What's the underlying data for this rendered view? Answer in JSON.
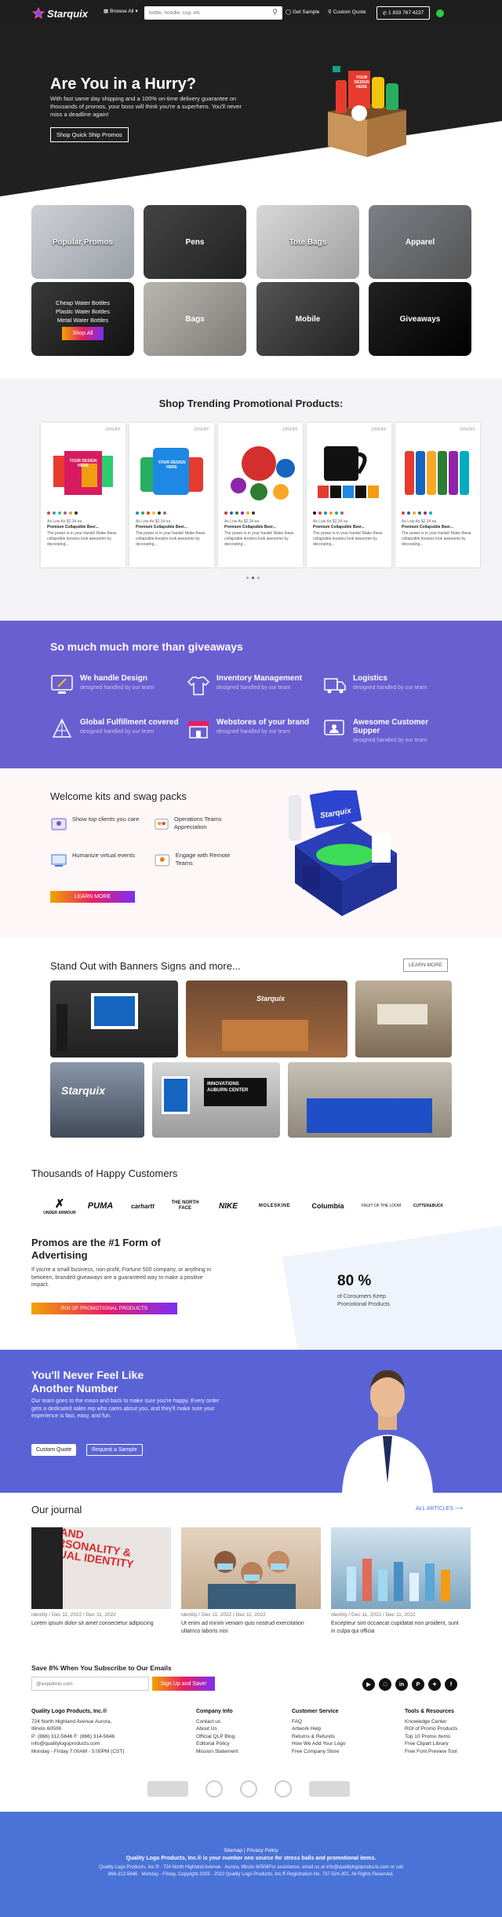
{
  "header": {
    "logo": "Starquix",
    "browse": "Browse All",
    "search_placeholder": "bottle, hoodie, cup, etc",
    "get_sample": "Get Sample",
    "custom_quote": "Custom Quote",
    "phone": "1 833 767 4237"
  },
  "hero": {
    "title": "Are You in a Hurry?",
    "body": "With fast same day shipping and a 100% on-time delivery guarantee on thousands of promos, your boss will think you're a superhero. You'll never miss a deadline again!",
    "button": "Shop Quick Ship Promos",
    "box_text": "YOUR DESIGN HERE"
  },
  "categories": [
    {
      "label": "Popular Promos"
    },
    {
      "label": "Pens"
    },
    {
      "label": "Tote Bags"
    },
    {
      "label": "Apparel"
    },
    {
      "label": "Cheap Water Bottles\nPlastic Water Bottles\nMetal Water Bottles"
    },
    {
      "label": "Bags"
    },
    {
      "label": "Mobile"
    },
    {
      "label": "Giveaways"
    }
  ],
  "categories_shop_all": "Shop All",
  "trending": {
    "title": "Shop Trending Promotional Products:",
    "products": [
      {
        "tag": "10%OFF",
        "price": "As Low As $2.34 ea",
        "title": "Premium Collapsible Beer...",
        "desc": "The power is in your hands! Make these collapsible koozies look awesome by decorating..."
      },
      {
        "tag": "10%OFF",
        "price": "As Low As $2.34 ea",
        "title": "Premium Collapsible Beer...",
        "desc": "The power is in your hands! Make these collapsible koozies look awesome by decorating..."
      },
      {
        "tag": "10%OFF",
        "price": "As Low As $2.34 ea",
        "title": "Premium Collapsible Beer...",
        "desc": "The power is in your hands! Make these collapsible koozies look awesome by decorating..."
      },
      {
        "tag": "10%OFF",
        "price": "As Low As $2.34 ea",
        "title": "Premium Collapsible Beer...",
        "desc": "The power is in your hands! Make these collapsible koozies look awesome by decorating..."
      },
      {
        "tag": "10%OFF",
        "price": "As Low As $2.34 ea",
        "title": "Premium Collapsible Beer...",
        "desc": "The power is in your hands! Make these collapsible koozies look awesome by decorating..."
      }
    ],
    "print_text": "YOUR DESIGN HERE"
  },
  "features": {
    "title": "So much much more than giveaways",
    "items": [
      {
        "title": "We handle Design",
        "sub": "designed handled by our team"
      },
      {
        "title": "Inventory Management",
        "sub": "designed handled by our team"
      },
      {
        "title": "Logistics",
        "sub": "designed handled by our team"
      },
      {
        "title": "Global Fulfillment covered",
        "sub": "designed handled by our team"
      },
      {
        "title": "Webstores of your brand",
        "sub": "designed handled by our team"
      },
      {
        "title": "Awesome Customer Supper",
        "sub": "designed handled by our team"
      }
    ]
  },
  "kits": {
    "title": "Welcome kits and swag packs",
    "items": [
      "Show top clients you care",
      "Operations Teams Appreciation",
      "Humanize virtual events",
      "Engage with Remote Teams"
    ],
    "button": "LEARN MORE",
    "brand": "Starquix"
  },
  "banners": {
    "title": "Stand Out with Banners Signs and more...",
    "button": "LEARN MORE",
    "sign1": "Starquix",
    "sign2": "INNOVATIONS\nAUBURN CENTER"
  },
  "customers": {
    "title": "Thousands of Happy Customers",
    "logos": [
      "UNDER ARMOUR",
      "PUMA",
      "carhartt",
      "THE NORTH FACE",
      "NIKE",
      "MOLESKINE",
      "Columbia",
      "FRUIT OF THE LOOM",
      "CUTTER&BUCK"
    ]
  },
  "promos": {
    "title": "Promos are the #1 Form of Advertising",
    "body": "If you're a small business, non-profit, Fortune 500 company, or anything in between, branded giveaways are a guaranteed way to make a positive impact.",
    "button": "ROI OF PROMOTIONAL PRODUCTS",
    "stat": "80 %",
    "stat_label": "of Consumers Keep Promotional Products"
  },
  "contact": {
    "title": "You'll Never Feel Like Another Number",
    "body": "Our team goes to the moon and back to make sure you're happy. Every order gets a dedicated sales rep who cares about you, and they'll make sure your experience is fast, easy, and fun.",
    "btn1": "Custom Quote",
    "btn2": "Request a Sample"
  },
  "journal": {
    "title": "Our journal",
    "all": "ALL ARTICLES",
    "posts": [
      {
        "meta": "identity / Dec 11, 2022 / Dec 11, 2022",
        "text": "Lorem ipsum dolor sit amet consectetur adipiscing",
        "img_text": "BRAND PERSONALITY & VISUAL IDENTITY"
      },
      {
        "meta": "identity / Dec 11, 2022 / Dec 11, 2022",
        "text": "Ut enim ad minim veniam quis nostrud exercitation ullamco laboris nisi"
      },
      {
        "meta": "identity / Dec 11, 2022 / Dec 11, 2022",
        "text": "Excepteur sint occaecat cupidatat non proident, sunt in culpa qui officia"
      }
    ]
  },
  "subscribe": {
    "title": "Save 8% When You Subscribe to Our Emails",
    "placeholder": "@expelimo.com",
    "button": "Sign Up and Save!"
  },
  "footer": {
    "company": {
      "name": "Quality Logo Products, Inc.®",
      "lines": [
        "724 North Highland Avenue Aurora,",
        "Illinois 60506",
        "P: (866) 312-5646 F: (866) 314-5646",
        "info@qualitylogoproducts.com",
        "Monday - Friday 7:00AM - 5:00PM (CST)"
      ]
    },
    "cols": [
      {
        "head": "Company Info",
        "items": [
          "Contact us",
          "About Us",
          "Official QLP Blog",
          "Editorial Policy",
          "Mission Statement"
        ]
      },
      {
        "head": "Customer Service",
        "items": [
          "FAQ",
          "Artwork Help",
          "Returns & Refunds",
          "How We Add Your Logo",
          "Free Company Store"
        ]
      },
      {
        "head": "Tools & Resources",
        "items": [
          "Knowledge Center",
          "ROI of Promo Products",
          "Top 10 Promo Items",
          "Free Clipart Library",
          "Free Font Preview Tool"
        ]
      }
    ],
    "bottom_links": "Sitemap | Privacy Policy",
    "bottom_title": "Quality Logo Products, Inc.® is your number one source for stress balls and promotional items.",
    "bottom_line1": "Quality Logo Products, Inc.® · 724 North Highland Avenue · Aurora, Illinois 60506For assistance, email us at info@qualitylogoproducts.com or call",
    "bottom_line2": "866-312-5646 · Monday - Friday. Copyright 2003 - 2022 Quality Logo Products, Inc.® Registration No. 737-524-201. All Rights Reserved."
  },
  "colors": {
    "purple": "#6a5fd1",
    "blue_contact": "#5a63d6",
    "footer_blue": "#4a73d8",
    "gradient": "#e8421b-#7b2ff7"
  }
}
